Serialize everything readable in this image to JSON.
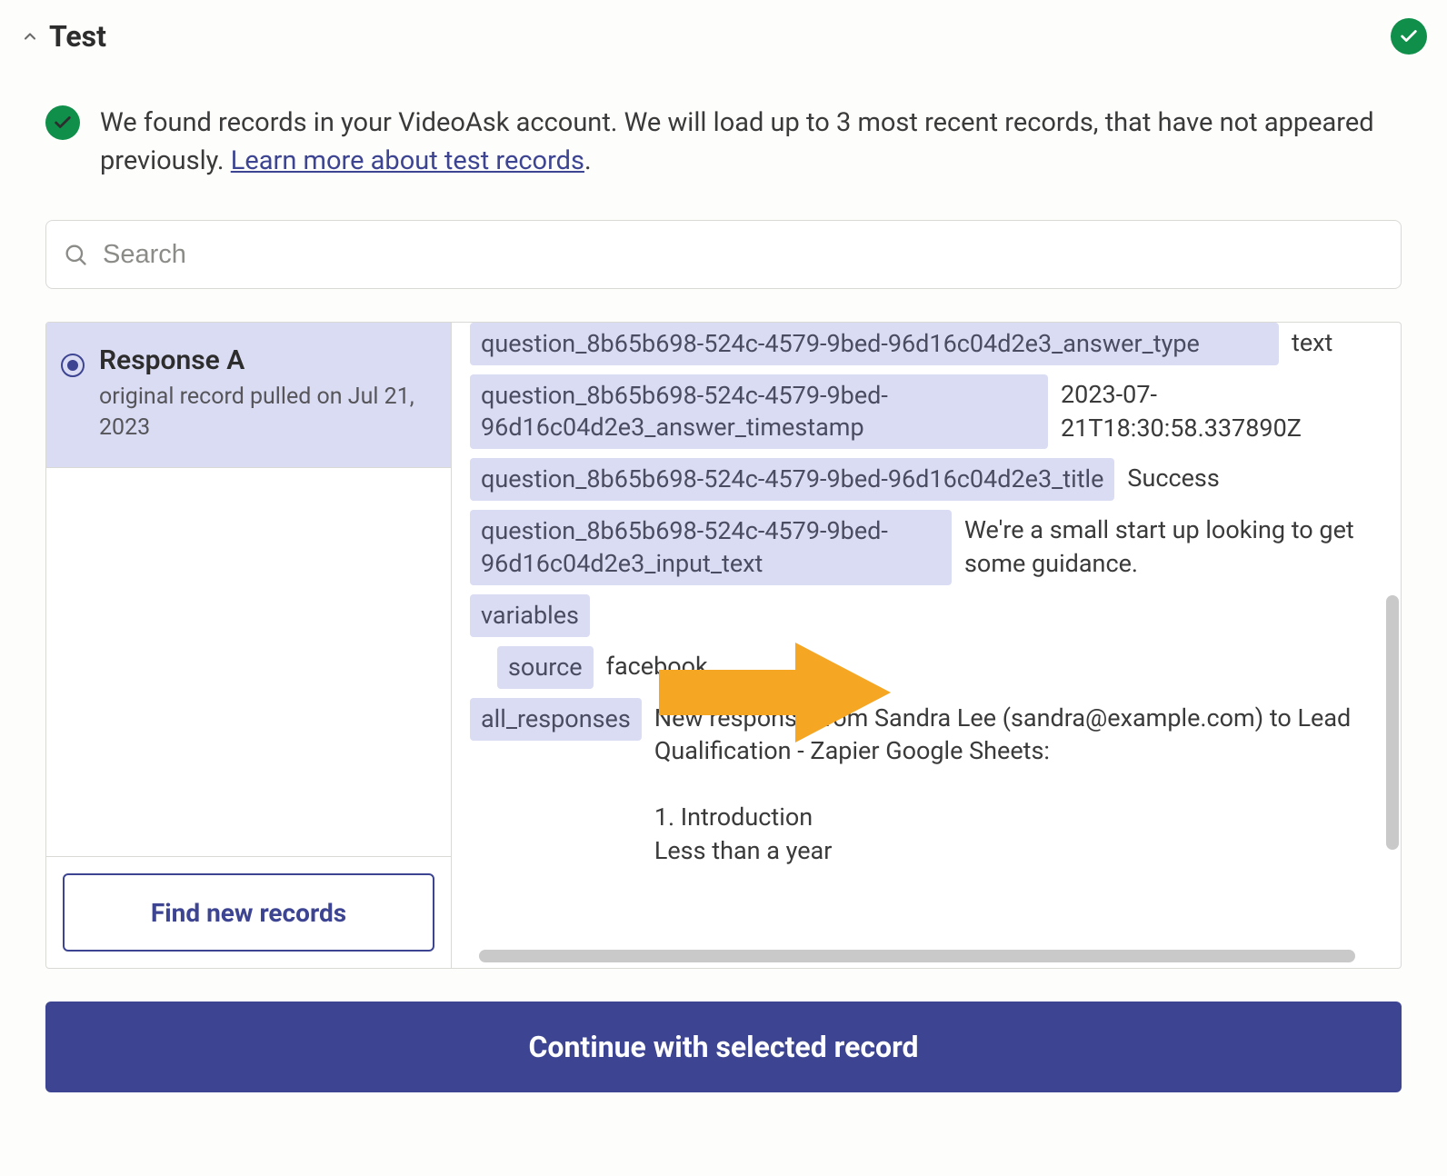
{
  "header": {
    "title": "Test"
  },
  "info": {
    "text_pre": "We found records in your VideoAsk account. We will load up to 3 most recent records, that have not appeared previously. ",
    "link_text": "Learn more about test records",
    "text_post": "."
  },
  "search": {
    "placeholder": "Search"
  },
  "records": {
    "selected": {
      "title": "Response A",
      "subtitle": "original record pulled on Jul 21, 2023"
    }
  },
  "details": [
    {
      "key": "question_8b65b698-524c-4579-9bed-96d16c04d2e3_answer_type",
      "key_width": 890,
      "value": "text",
      "indent": false
    },
    {
      "key": "question_8b65b698-524c-4579-9bed-96d16c04d2e3_answer_timestamp",
      "key_width": 636,
      "value": "2023-07-21T18:30:58.337890Z",
      "indent": false
    },
    {
      "key": "question_8b65b698-524c-4579-9bed-96d16c04d2e3_title",
      "key_width": 0,
      "value": "Success",
      "indent": false
    },
    {
      "key": "question_8b65b698-524c-4579-9bed-96d16c04d2e3_input_text",
      "key_width": 530,
      "value": "We're a small start up looking to get some guidance.",
      "indent": false
    },
    {
      "key": "variables",
      "key_width": 0,
      "value": "",
      "indent": false
    },
    {
      "key": "source",
      "key_width": 0,
      "value": "facebook",
      "indent": true
    },
    {
      "key": "all_responses",
      "key_width": 0,
      "value": "New response from Sandra Lee (sandra@example.com) to Lead Qualification - Zapier Google Sheets:\n\n1. Introduction\nLess than a year",
      "indent": false
    }
  ],
  "buttons": {
    "find_new": "Find new records",
    "continue": "Continue with selected record"
  }
}
